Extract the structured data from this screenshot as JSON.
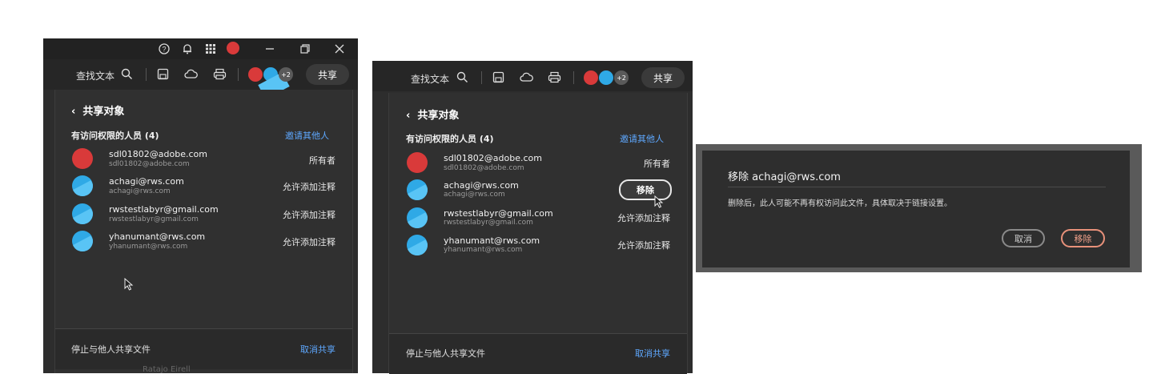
{
  "colors": {
    "panel_bg": "#2d2d2d",
    "link": "#5ea8ff",
    "remove_accent": "#e8917a",
    "avatar_blue": "#2fa9e6"
  },
  "toolbar": {
    "find_label": "查找文本",
    "share_label": "共享",
    "extra_count": "+2",
    "icons": [
      "search-icon",
      "save-icon",
      "cloud-icon",
      "print-icon",
      "help-icon",
      "bell-icon",
      "apps-grid-icon"
    ]
  },
  "panel": {
    "back_title": "共享对象",
    "section_title": "有访问权限的人员 (4)",
    "invite_label": "邀请其他人",
    "people": [
      {
        "name": "sdl01802@adobe.com",
        "sub": "sdl01802@adobe.com",
        "role": "所有者"
      },
      {
        "name": "achagi@rws.com",
        "sub": "achagi@rws.com",
        "role": "允许添加注释"
      },
      {
        "name": "rwstestlabyr@gmail.com",
        "sub": "rwstestlabyr@gmail.com",
        "role": "允许添加注释"
      },
      {
        "name": "yhanumant@rws.com",
        "sub": "yhanumant@rws.com",
        "role": "允许添加注释"
      }
    ],
    "remove_label": "移除",
    "footer_left": "停止与他人共享文件",
    "footer_right": "取消共享"
  },
  "dialog": {
    "title": "移除 achagi@rws.com",
    "message": "删除后，此人可能不再有权访问此文件，具体取决于链接设置。",
    "cancel_label": "取消",
    "confirm_label": "移除"
  },
  "behind": {
    "partial_text": "Ratajo Eirell"
  }
}
